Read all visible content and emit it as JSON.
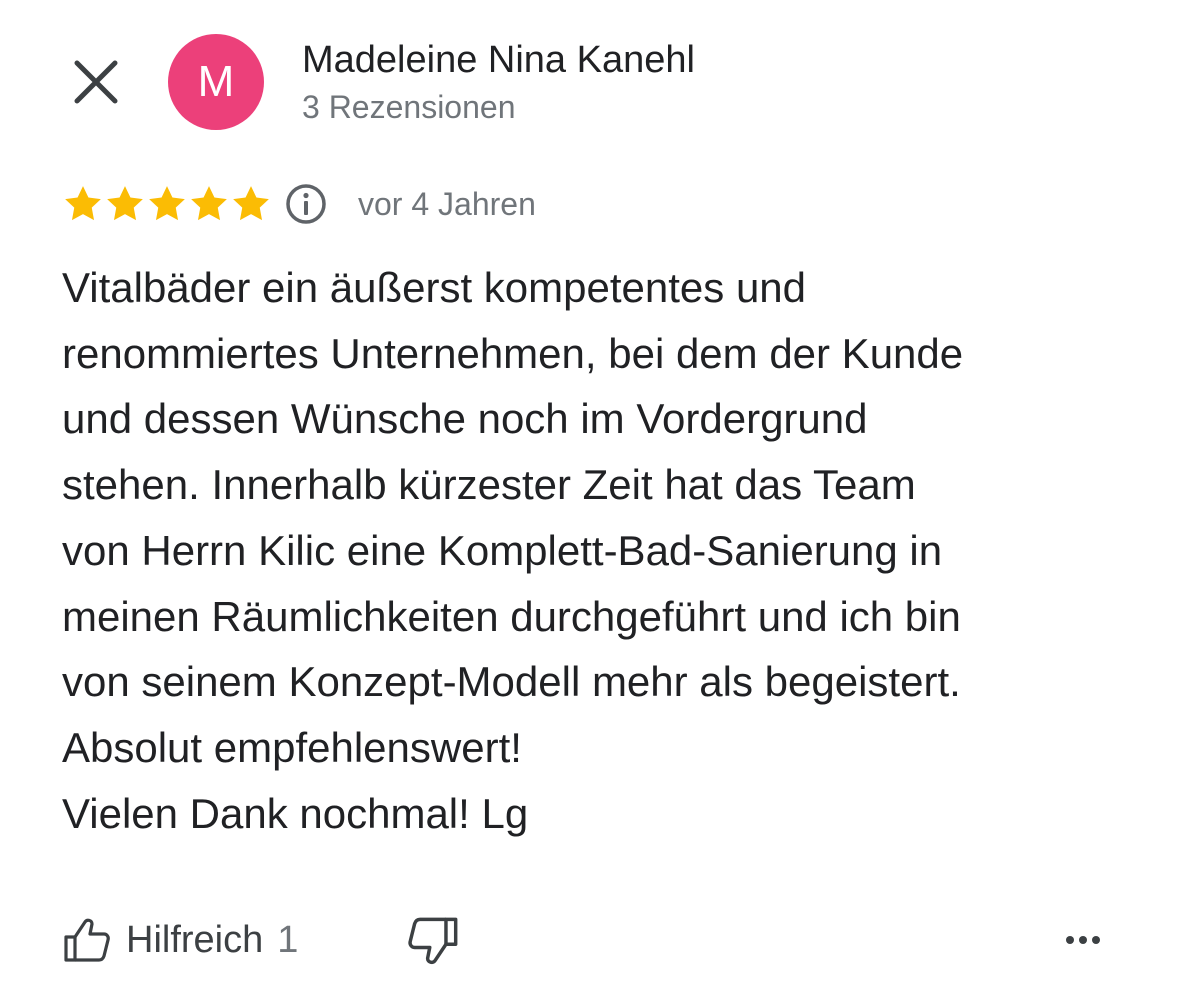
{
  "header": {
    "close_icon": "close-icon",
    "avatar_letter": "M",
    "avatar_color": "#ec407a",
    "author_name": "Madeleine Nina Kanehl",
    "review_count": "3 Rezensionen"
  },
  "rating": {
    "stars": 5,
    "max_stars": 5,
    "star_color": "#fbbc04",
    "info_icon": "info-icon",
    "date": "vor 4 Jahren"
  },
  "review": {
    "lines": [
      "Vitalbäder ein äußerst kompetentes und",
      "renommiertes Unternehmen, bei dem der Kunde",
      "und dessen Wünsche noch im Vordergrund",
      "stehen. Innerhalb kürzester Zeit hat das Team",
      "von Herrn Kilic eine Komplett-Bad-Sanierung in",
      "meinen Räumlichkeiten durchgeführt und ich bin",
      "von seinem Konzept-Modell mehr als begeistert.",
      "Absolut empfehlenswert!",
      "Vielen Dank nochmal! Lg"
    ]
  },
  "actions": {
    "helpful_label": "Hilfreich",
    "helpful_count": "1",
    "thumbs_up_icon": "thumbs-up-icon",
    "thumbs_down_icon": "thumbs-down-icon",
    "more_icon": "more-horizontal-icon"
  }
}
